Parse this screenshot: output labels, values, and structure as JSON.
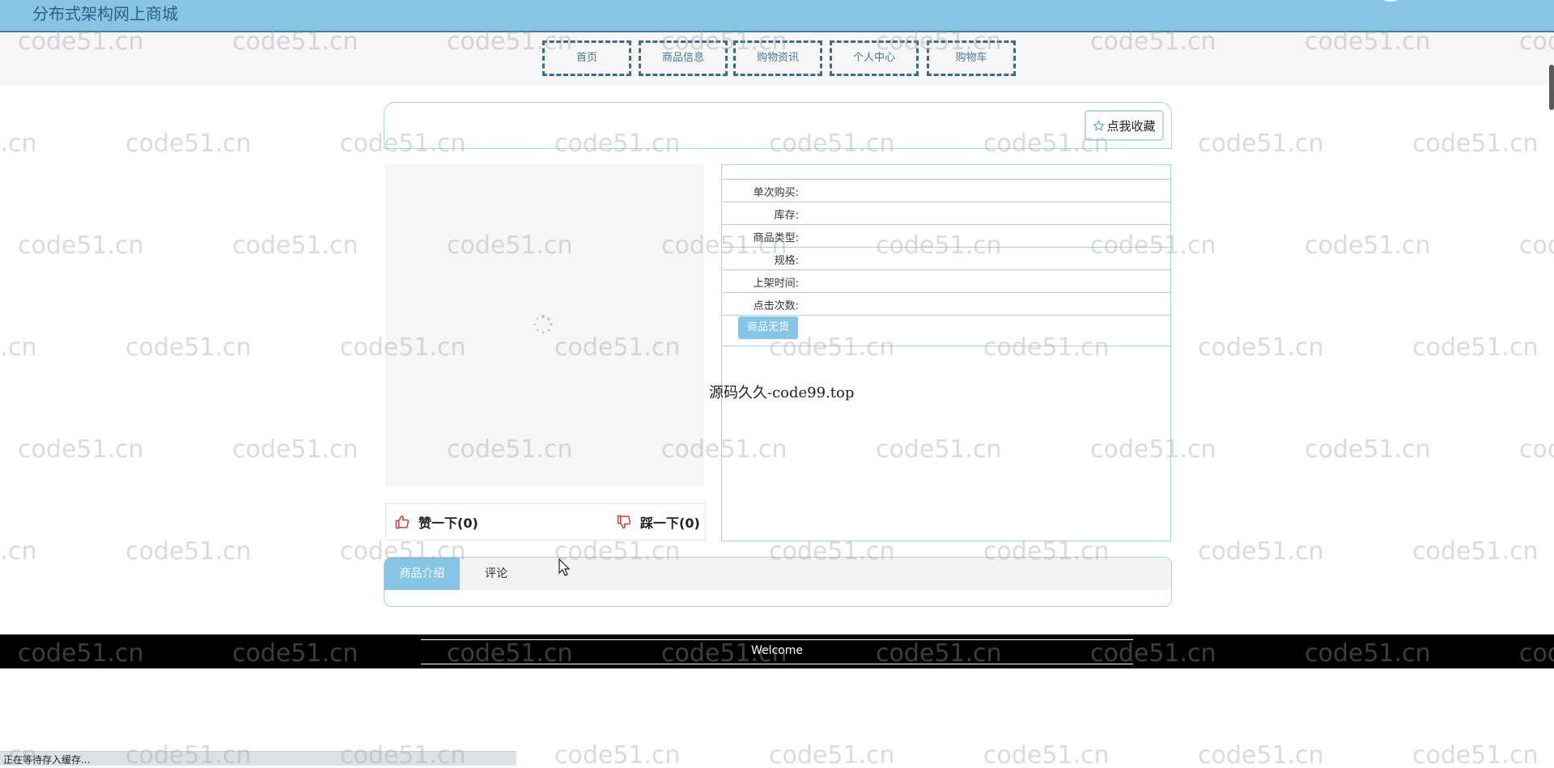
{
  "site_title": "分布式架构网上商城",
  "nav": [
    "首页",
    "商品信息",
    "购物资讯",
    "个人中心",
    "购物车"
  ],
  "favorite_label": "点我收藏",
  "product": {
    "labels": [
      "单次购买:",
      "库存:",
      "商品类型:",
      "规格:",
      "上架时间:",
      "点击次数:"
    ],
    "stock_button": "商品无货"
  },
  "votes": {
    "like": "赞一下(0)",
    "dislike": "踩一下(0)"
  },
  "source_text": "源码久久-code99.top",
  "tabs": [
    "商品介绍",
    "评论"
  ],
  "footer_text": "Welcome",
  "status_text": "正在等待存入缓存...",
  "watermark": "code51.cn",
  "colors": {
    "accent": "#86c5e6",
    "nav_border": "#3a6b93",
    "like": "#d23b3b",
    "footer": "#000000"
  },
  "icons": [
    "star-icon",
    "thumbs-up-icon",
    "thumbs-down-icon",
    "loading-spinner-icon",
    "mouse-cursor-icon"
  ]
}
